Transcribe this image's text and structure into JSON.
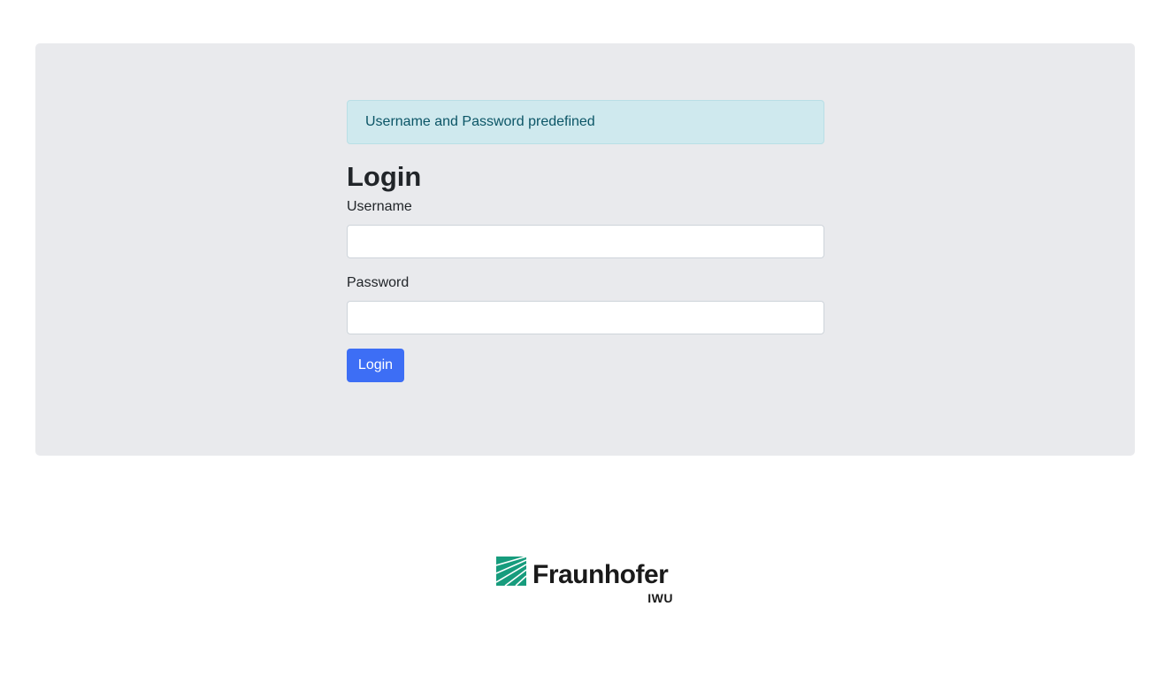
{
  "alert": {
    "message": "Username and Password predefined"
  },
  "login": {
    "title": "Login",
    "username_label": "Username",
    "username_value": "",
    "password_label": "Password",
    "password_value": "",
    "submit_label": "Login"
  },
  "footer": {
    "logo_name": "Fraunhofer",
    "logo_subtitle": "IWU",
    "logo_icon": "fraunhofer-stripes-icon",
    "logo_color": "#179c7d"
  },
  "colors": {
    "panel_bg": "#e9eaed",
    "alert_bg": "#cfe9ee",
    "alert_text": "#0b5566",
    "primary_button": "#3d6ef5"
  }
}
